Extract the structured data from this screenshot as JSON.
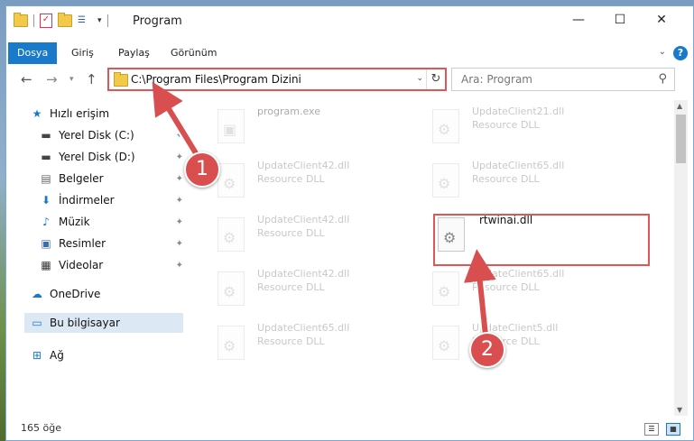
{
  "window": {
    "title": "Program"
  },
  "controls": {
    "minimize": "—",
    "maximize": "☐",
    "close": "✕"
  },
  "ribbon": {
    "tabs": [
      "Dosya",
      "Giriş",
      "Paylaş",
      "Görünüm"
    ],
    "help": "?"
  },
  "address": {
    "path": "C:\\Program Files\\Program Dizini"
  },
  "search": {
    "placeholder": "Ara: Program"
  },
  "sidebar": {
    "quick_access": "Hızlı erişim",
    "items": [
      {
        "label": "Yerel Disk (C:)",
        "icon": "drive-icon"
      },
      {
        "label": "Yerel Disk (D:)",
        "icon": "drive-icon"
      },
      {
        "label": "Belgeler",
        "icon": "documents-icon"
      },
      {
        "label": "İndirmeler",
        "icon": "downloads-icon"
      },
      {
        "label": "Müzik",
        "icon": "music-icon"
      },
      {
        "label": "Resimler",
        "icon": "pictures-icon"
      },
      {
        "label": "Videolar",
        "icon": "videos-icon"
      }
    ],
    "onedrive": "OneDrive",
    "this_pc": "Bu bilgisayar",
    "network": "Ağ"
  },
  "files": [
    {
      "name": "program.exe",
      "type": ""
    },
    {
      "name": "UpdateClient21.dll",
      "type": "Resource DLL"
    },
    {
      "name": "UpdateClient42.dll",
      "type": "Resource DLL"
    },
    {
      "name": "UpdateClient65.dll",
      "type": "Resource DLL"
    },
    {
      "name": "UpdateClient42.dll",
      "type": "Resource DLL"
    },
    {
      "name": "rtwinai.dll",
      "type": ""
    },
    {
      "name": "UpdateClient42.dll",
      "type": "Resource DLL"
    },
    {
      "name": "UpdateClient65.dll",
      "type": "Resource DLL"
    },
    {
      "name": "UpdateClient65.dll",
      "type": "Resource DLL"
    },
    {
      "name": "UpdateClient5.dll",
      "type": "Resource DLL"
    }
  ],
  "status": {
    "count": "165 öğe"
  },
  "annotations": {
    "step1": "1",
    "step2": "2"
  },
  "colors": {
    "accent": "#1979ca",
    "highlight": "#e05555"
  }
}
